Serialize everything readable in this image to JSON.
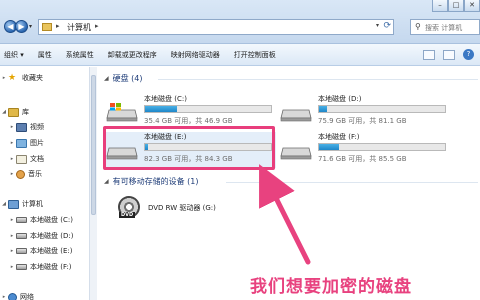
{
  "address_bar": {
    "path_root_sep": "▸",
    "path": "计算机",
    "path_sep": "▸",
    "search_placeholder": "搜索 计算机"
  },
  "window_controls": {
    "minimize": "–",
    "maximize": "□",
    "close": "✕"
  },
  "toolbar": {
    "items": [
      "组织 ▾",
      "属性",
      "系统属性",
      "卸载或更改程序",
      "映射网络驱动器",
      "打开控制面板"
    ]
  },
  "sidebar": {
    "items": [
      {
        "label": "收藏夹",
        "icon": "star-icon"
      },
      {
        "label": "库",
        "icon": "library-icon"
      },
      {
        "label": "视频",
        "icon": "video-icon"
      },
      {
        "label": "图片",
        "icon": "picture-icon"
      },
      {
        "label": "文档",
        "icon": "document-icon"
      },
      {
        "label": "音乐",
        "icon": "music-icon"
      },
      {
        "label": "计算机",
        "icon": "computer-icon"
      },
      {
        "label": "本地磁盘 (C:)",
        "icon": "drive-icon"
      },
      {
        "label": "本地磁盘 (D:)",
        "icon": "drive-icon"
      },
      {
        "label": "本地磁盘 (E:)",
        "icon": "drive-icon"
      },
      {
        "label": "本地磁盘 (F:)",
        "icon": "drive-icon"
      },
      {
        "label": "网络",
        "icon": "network-icon"
      }
    ]
  },
  "main": {
    "groups": [
      {
        "label": "硬盘 (4)"
      },
      {
        "label": "有可移动存储的设备 (1)"
      }
    ],
    "drives": [
      {
        "name": "本地磁盘 (C:)",
        "free": "35.4 GB 可用，共 46.9 GB",
        "used_fraction": 0.25,
        "bar_color": "#1e86c9"
      },
      {
        "name": "本地磁盘 (D:)",
        "free": "75.9 GB 可用，共 81.1 GB",
        "used_fraction": 0.06,
        "bar_color": "#1e86c9"
      },
      {
        "name": "本地磁盘 (E:)",
        "free": "82.3 GB 可用，共 84.3 GB",
        "used_fraction": 0.02,
        "bar_color": "#1e86c9"
      },
      {
        "name": "本地磁盘 (F:)",
        "free": "71.6 GB 可用，共 85.5 GB",
        "used_fraction": 0.16,
        "bar_color": "#1e86c9"
      }
    ],
    "dvd": {
      "name": "DVD RW 驱动器 (G:)",
      "tag": "DVD"
    }
  },
  "annotation": {
    "text": "我们想要加密的磁盘",
    "color": "#e8427f"
  }
}
